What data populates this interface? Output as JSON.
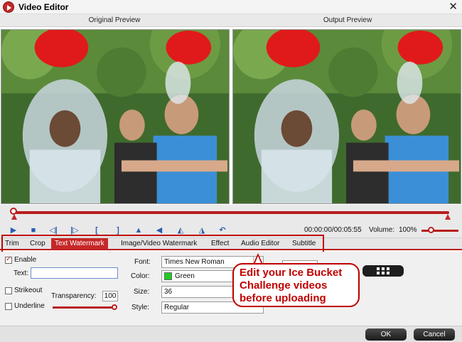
{
  "window": {
    "title": "Video Editor",
    "close_icon": "close-icon"
  },
  "preview": {
    "original_label": "Original Preview",
    "output_label": "Output Preview"
  },
  "playback": {
    "time": "00:00:00/00:05:55",
    "volume_label": "Volume:",
    "volume_value": "100%",
    "volume_level": 0.15,
    "progress": 0.0,
    "icons": [
      "play-icon",
      "stop-icon",
      "prev-frame-icon",
      "next-frame-icon",
      "set-start-icon",
      "set-end-icon",
      "flip-vertical-icon",
      "flip-left-icon",
      "rotate-left-icon",
      "rotate-right-icon",
      "undo-icon"
    ]
  },
  "tabs": [
    {
      "label": "Trim"
    },
    {
      "label": "Crop"
    },
    {
      "label": "Text Watermark",
      "active": true
    },
    {
      "label": "Image/Video Watermark"
    },
    {
      "label": "Effect"
    },
    {
      "label": "Audio Editor"
    },
    {
      "label": "Subtitle"
    }
  ],
  "watermark": {
    "enable_label": "Enable",
    "enable_checked": true,
    "text_label": "Text:",
    "text_value": "",
    "strikeout_label": "Strikeout",
    "underline_label": "Underline",
    "transparency_label": "Transparency:",
    "transparency_value": "100",
    "font_label": "Font:",
    "font_value": "Times New Roman",
    "color_label": "Color:",
    "color_value": "Green",
    "color_hex": "#22cc22",
    "size_label": "Size:",
    "size_value": "36",
    "style_label": "Style:",
    "style_value": "Regular"
  },
  "callout": {
    "line1": "Edit your Ice Bucket",
    "line2": "Challenge videos",
    "line3": "before uploading",
    "color": "#c00000"
  },
  "buttons": {
    "ok": "OK",
    "cancel": "Cancel"
  },
  "colors": {
    "accent": "#c62828",
    "control_blue": "#2a5db0"
  }
}
